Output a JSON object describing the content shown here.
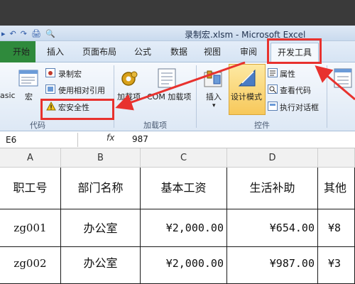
{
  "window": {
    "title": "录制宏.xlsm - Microsoft Excel"
  },
  "quick_access": {
    "items": [
      "▸",
      "↶",
      "↷",
      "🖨",
      "🔍"
    ]
  },
  "tabs": {
    "file": "",
    "items": [
      "开始",
      "插入",
      "页面布局",
      "公式",
      "数据",
      "视图",
      "审阅",
      "开发工具"
    ],
    "active": "开发工具"
  },
  "ribbon": {
    "code_group": {
      "name": "代码",
      "visual_basic": "asic",
      "macros": "宏",
      "record_macro": "录制宏",
      "relative_refs": "使用相对引用",
      "macro_security": "宏安全性"
    },
    "addins_group": {
      "name": "加载项",
      "addins": "加载项",
      "com_addins": "COM 加载项"
    },
    "controls_group": {
      "name": "控件",
      "insert": "插入",
      "design_mode": "设计模式",
      "properties": "属性",
      "view_code": "查看代码",
      "run_dialog": "执行对话框"
    }
  },
  "formula_bar": {
    "name_box": "E6",
    "fx": "fx",
    "value": "987"
  },
  "sheet": {
    "column_headers": [
      "A",
      "B",
      "C",
      "D",
      ""
    ],
    "header_row": [
      "职工号",
      "部门名称",
      "基本工资",
      "生活补助",
      "其他"
    ],
    "rows": [
      [
        "zg001",
        "办公室",
        "¥2,000.00",
        "¥654.00",
        "¥8"
      ],
      [
        "zg002",
        "办公室",
        "¥2,000.00",
        "¥987.00",
        "¥3"
      ]
    ]
  },
  "colors": {
    "highlight": "#e8322e",
    "file_tab": "#2f8a3c",
    "ribbon": "#dde8f5"
  }
}
